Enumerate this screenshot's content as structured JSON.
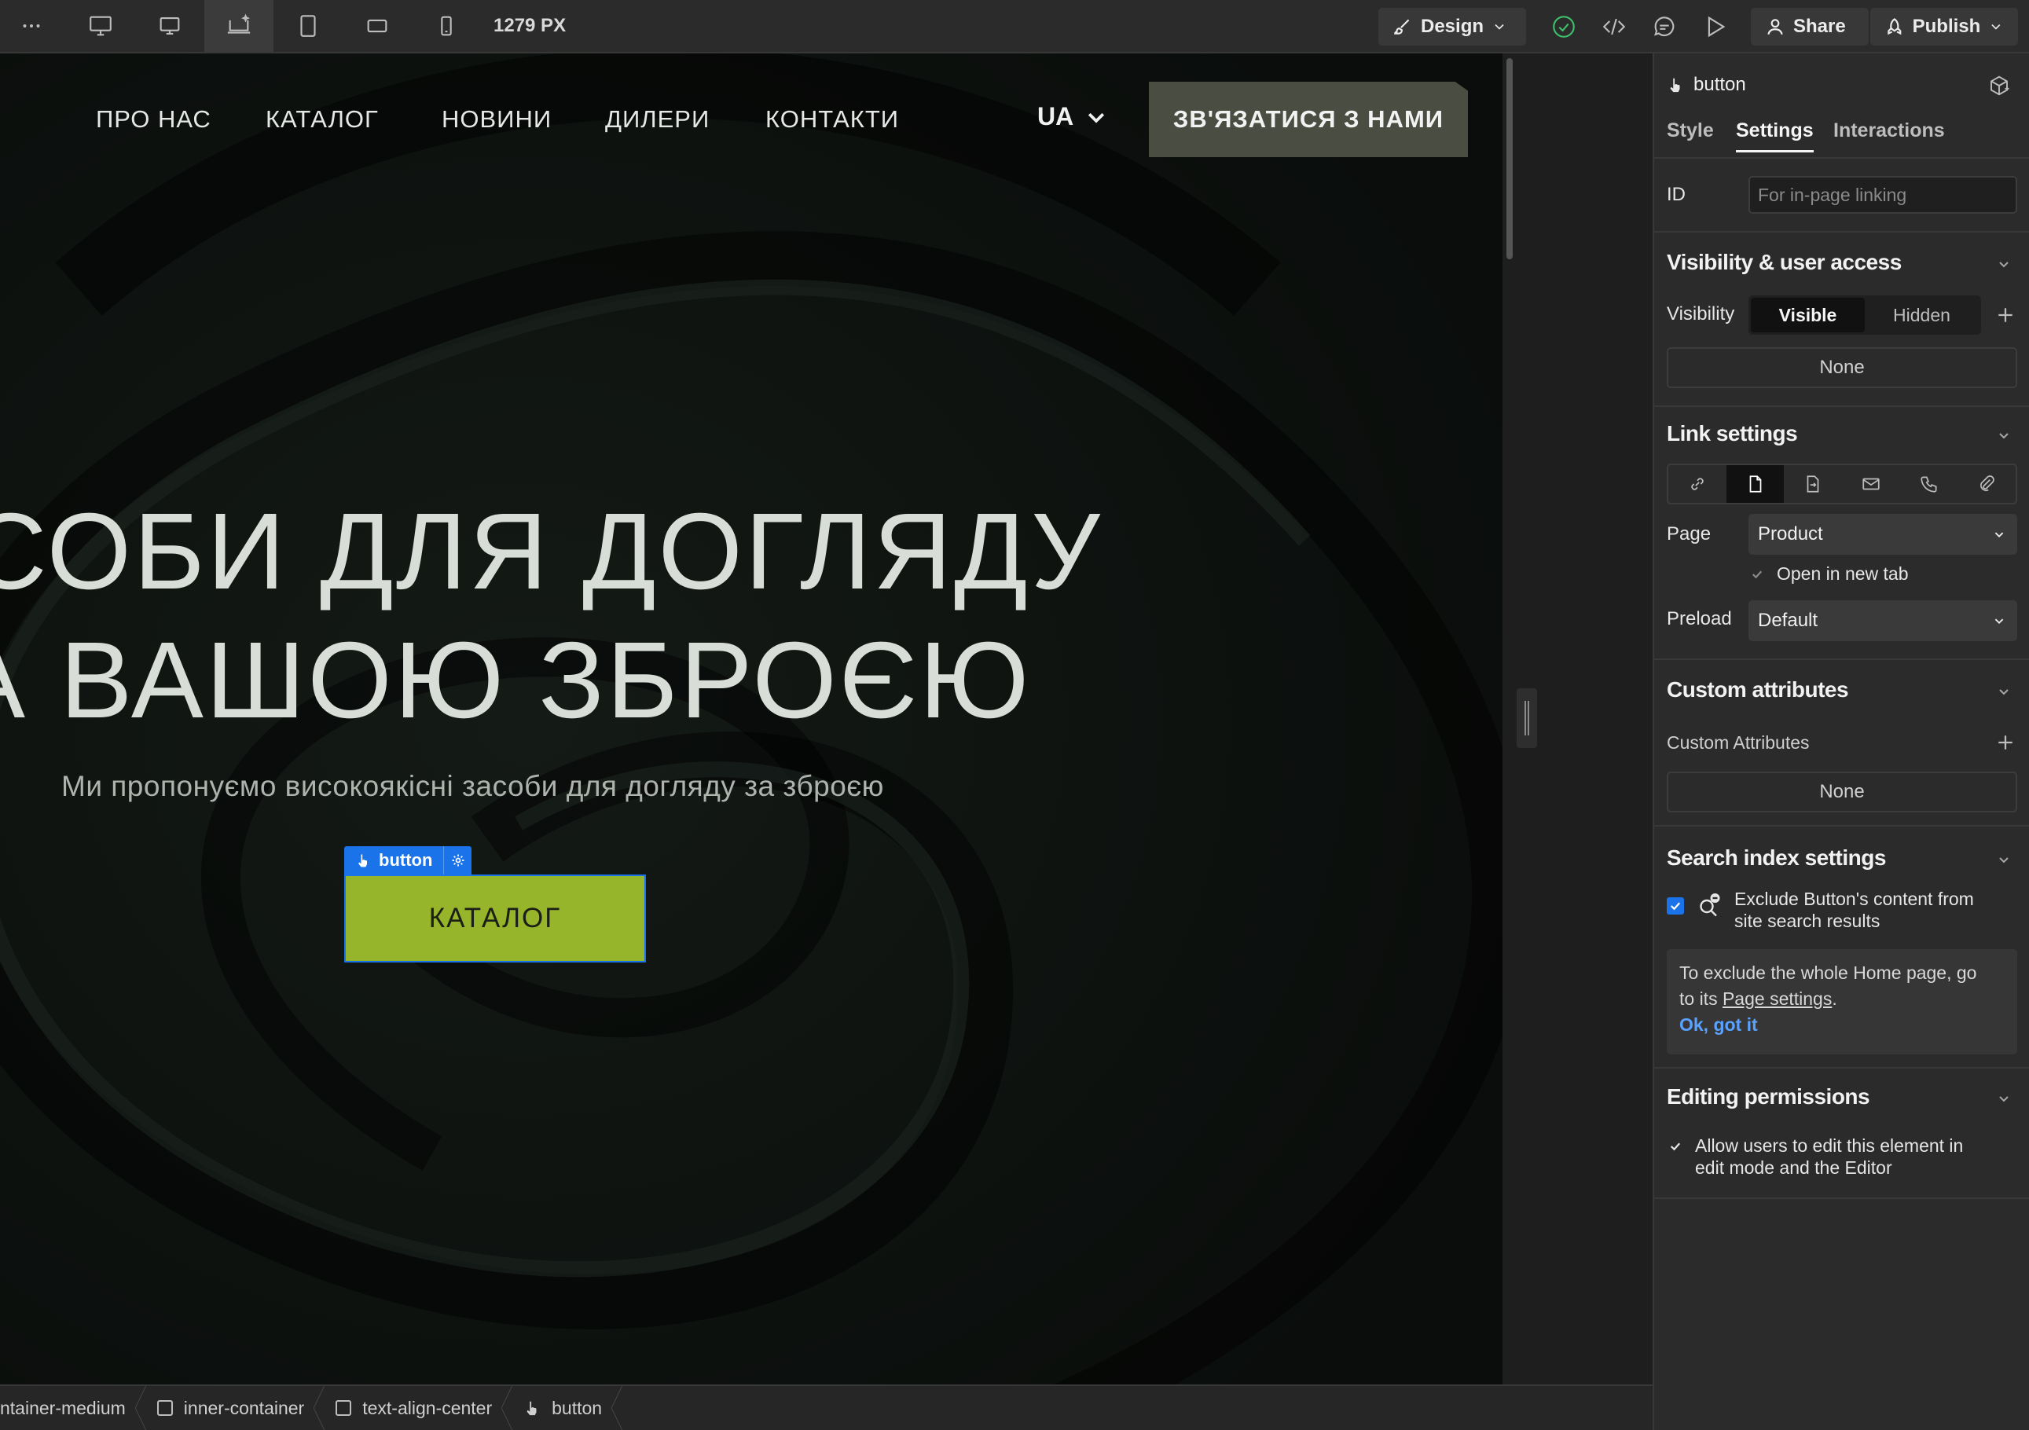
{
  "toolbar": {
    "more_icon": "more-horizontal-icon",
    "breakpoints": [
      "desktop-large-icon",
      "desktop-icon",
      "desktop-base-icon",
      "tablet-icon",
      "mobile-landscape-icon",
      "mobile-portrait-icon"
    ],
    "width_readout": "1279 PX",
    "mode_label": "Design",
    "share_label": "Share",
    "publish_label": "Publish"
  },
  "site": {
    "nav": [
      "ПРО НАС",
      "КАТАЛОГ",
      "НОВИНИ",
      "ДИЛЕРИ",
      "КОНТАКТИ"
    ],
    "lang": "UA",
    "contact_button": "ЗВ'ЯЗАТИСЯ З НАМИ",
    "hero_line1": "СОБИ ДЛЯ ДОГЛЯДУ",
    "hero_line2": "А ВАШОЮ ЗБРОЄЮ",
    "hero_sub": "Ми пропонуємо високоякісні засоби для догляду за зброєю",
    "cta_button": "КАТАЛОГ"
  },
  "selection": {
    "label": "button"
  },
  "breadcrumbs": [
    "ntainer-medium",
    "inner-container",
    "text-align-center",
    "button"
  ],
  "panel": {
    "element_name": "button",
    "tabs": [
      "Style",
      "Settings",
      "Interactions"
    ],
    "active_tab": "Settings",
    "id_label": "ID",
    "id_placeholder": "For in-page linking",
    "visibility_section": {
      "title": "Visibility & user access",
      "visibility_label": "Visibility",
      "options": [
        "Visible",
        "Hidden"
      ],
      "selected": "Visible",
      "none": "None"
    },
    "link_section": {
      "title": "Link settings",
      "types": [
        "url-link-icon",
        "page-icon",
        "page-section-icon",
        "email-icon",
        "phone-icon",
        "attachment-icon"
      ],
      "page_label": "Page",
      "page_value": "Product",
      "new_tab_label": "Open in new tab",
      "new_tab_checked": true,
      "preload_label": "Preload",
      "preload_value": "Default"
    },
    "attrs_section": {
      "title": "Custom attributes",
      "label": "Custom Attributes",
      "none": "None"
    },
    "search_section": {
      "title": "Search index settings",
      "exclude_line1": "Exclude Button's content from",
      "exclude_line2": "site search results",
      "exclude_checked": true,
      "note_line1": "To exclude the whole Home page, go",
      "note_line2_prefix": "to its",
      "note_link": "Page settings",
      "note_line2_suffix": ".",
      "ok_label": "Ok, got it"
    },
    "perm_section": {
      "title": "Editing permissions",
      "allow_line1": "Allow users to edit this element in",
      "allow_line2": "edit mode and the Editor",
      "allow_checked": true
    }
  },
  "colors": {
    "accent_blue": "#1a73e8",
    "cta_green": "#97b52a",
    "contact_btn": "#4a4e42",
    "panel_bg": "#2b2b2b"
  }
}
